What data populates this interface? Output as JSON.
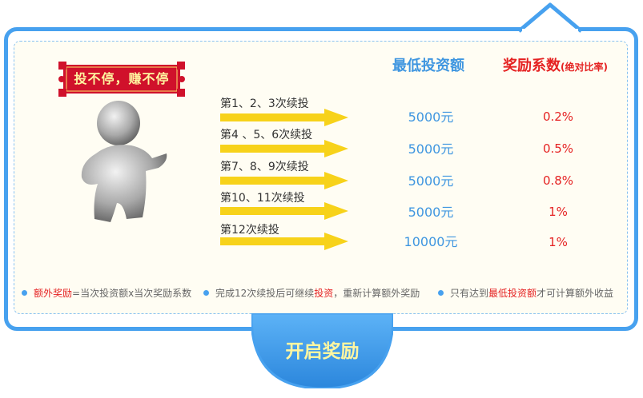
{
  "banner": {
    "text": "投不停，赚不停"
  },
  "headers": {
    "min_invest": "最低投资额",
    "coef": "奖励系数",
    "coef_sub": "(绝对比率)"
  },
  "rows": [
    {
      "step": "第1、2、3次续投",
      "amount": "5000元",
      "rate": "0.2%"
    },
    {
      "step": "第4 、5、6次续投",
      "amount": "5000元",
      "rate": "0.5%"
    },
    {
      "step": "第7、8、9次续投",
      "amount": "5000元",
      "rate": "0.8%"
    },
    {
      "step": "第10、11次续投",
      "amount": "5000元",
      "rate": "1%"
    },
    {
      "step": "第12次续投",
      "amount": "10000元",
      "rate": "1%"
    }
  ],
  "notes": {
    "n1_hl": "额外奖励",
    "n1_rest": "=当次投资额x当次奖励系数",
    "n2_a": "完成12次续投后可继续",
    "n2_hl": "投资",
    "n2_b": "，重新计算额外奖励",
    "n3_a": "只有达到",
    "n3_hl": "最低投资额",
    "n3_b": "才可计算额外收益"
  },
  "button": {
    "label": "开启奖励"
  },
  "colors": {
    "frame": "#47a1ef",
    "accent_red": "#e52222",
    "arrow": "#f7d21a",
    "banner_bg": "#d0112b",
    "button_text": "#fff6a0"
  }
}
